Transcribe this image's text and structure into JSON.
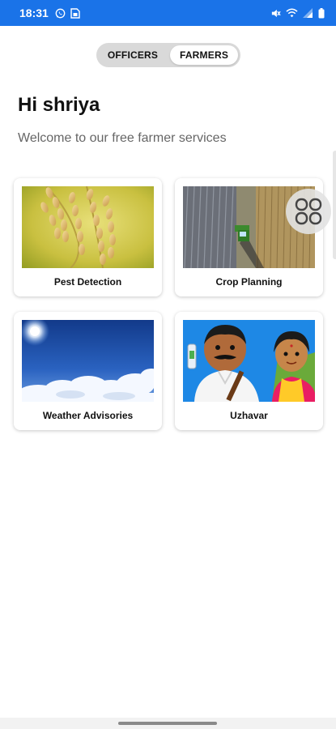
{
  "status_bar": {
    "time": "18:31",
    "left_icons": [
      "whatsapp-icon",
      "sim-card-icon"
    ],
    "right_icons": [
      "mute-icon",
      "wifi-icon",
      "signal-icon",
      "battery-icon"
    ],
    "background_color": "#1a73e8"
  },
  "toggle": {
    "options": [
      "OFFICERS",
      "FARMERS"
    ],
    "selected": "FARMERS"
  },
  "header": {
    "greeting": "Hi shriya",
    "subtitle": "Welcome to our free farmer services"
  },
  "services": [
    {
      "label": "Pest Detection",
      "image": "rice-grains"
    },
    {
      "label": "Crop Planning",
      "image": "harvester-field"
    },
    {
      "label": "Weather Advisories",
      "image": "sky-clouds-sun"
    },
    {
      "label": "Uzhavar",
      "image": "farmer-couple-cartoon"
    }
  ],
  "fab": {
    "icon": "grid-icon"
  }
}
